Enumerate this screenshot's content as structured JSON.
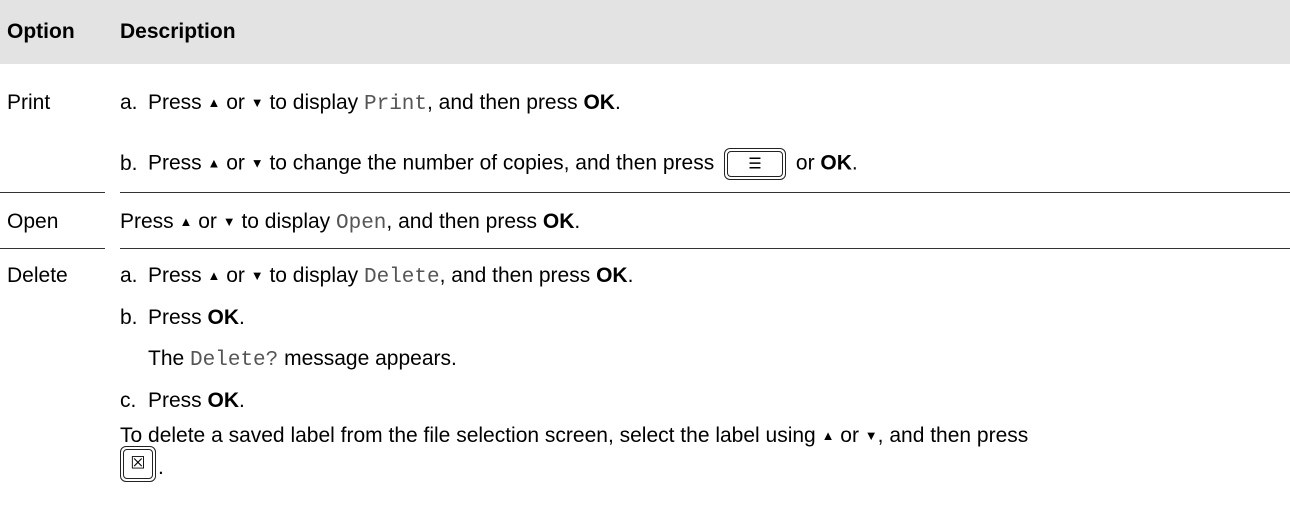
{
  "header": {
    "option": "Option",
    "description": "Description"
  },
  "icons": {
    "up": "▲",
    "down": "▼",
    "print_glyph": "☰",
    "delete_glyph": "☒"
  },
  "rows": {
    "print": {
      "name": "Print",
      "a": {
        "marker": "a.",
        "t1": "Press ",
        "t2": " or ",
        "t3": " to display ",
        "code": "Print",
        "t4": ", and then press ",
        "ok": "OK",
        "t5": "."
      },
      "b": {
        "marker": "b.",
        "t1": "Press ",
        "t2": " or ",
        "t3": " to change the number of copies, and then press ",
        "t4": " or ",
        "ok": "OK",
        "t5": "."
      }
    },
    "open": {
      "name": "Open",
      "t1": "Press ",
      "t2": " or ",
      "t3": " to display ",
      "code": "Open",
      "t4": ", and then press ",
      "ok": "OK",
      "t5": "."
    },
    "delete": {
      "name": "Delete",
      "a": {
        "marker": "a.",
        "t1": "Press ",
        "t2": " or ",
        "t3": " to display ",
        "code": "Delete",
        "t4": ", and then press ",
        "ok": "OK",
        "t5": "."
      },
      "b": {
        "marker": "b.",
        "t1": "Press ",
        "ok": "OK",
        "t5": "."
      },
      "msg": {
        "t1": "The ",
        "code": "Delete?",
        "t2": " message appears."
      },
      "c": {
        "marker": "c.",
        "t1": "Press ",
        "ok": "OK",
        "t5": "."
      },
      "note": {
        "t1": "To delete a saved label from the file selection screen, select the label using ",
        "t2": " or ",
        "t3": ", and then press"
      },
      "period": "."
    }
  }
}
